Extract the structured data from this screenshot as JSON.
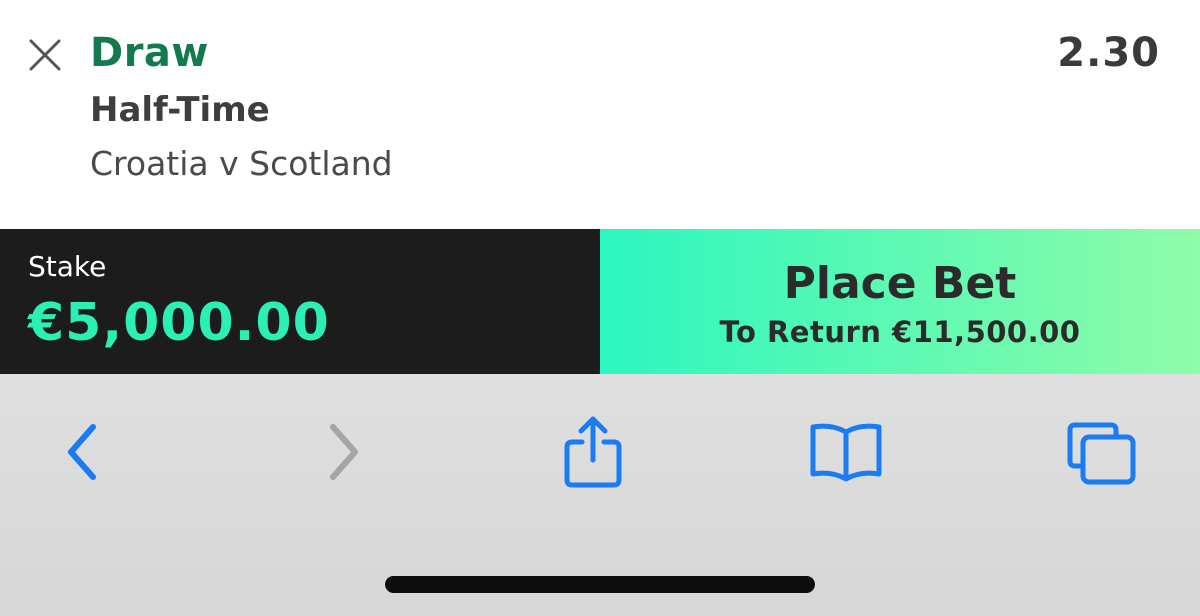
{
  "colors": {
    "selection_green": "#137a4e",
    "stake_value_green": "#2cf0b3",
    "stake_bar_bg": "#1c1c1c",
    "place_bet_gradient_start": "#2cf6bf",
    "place_bet_gradient_end": "#8ffca8",
    "toolbar_blue": "#1a7bf2",
    "toolbar_disabled": "#a5a5a5",
    "toolbar_bg": "#dbdcdb"
  },
  "bet_slip": {
    "selection": "Draw",
    "odds": "2.30",
    "market": "Half-Time",
    "event": "Croatia v Scotland",
    "close_icon": "close-icon"
  },
  "stake": {
    "label": "Stake",
    "value": "€5,000.00"
  },
  "place_bet": {
    "label": "Place Bet",
    "to_return": "To Return €11,500.00"
  },
  "browser_toolbar": {
    "back_icon": "chevron-left-icon",
    "forward_icon": "chevron-right-icon",
    "forward_enabled": false,
    "share_icon": "share-icon",
    "bookmarks_icon": "book-icon",
    "tabs_icon": "tabs-icon"
  }
}
